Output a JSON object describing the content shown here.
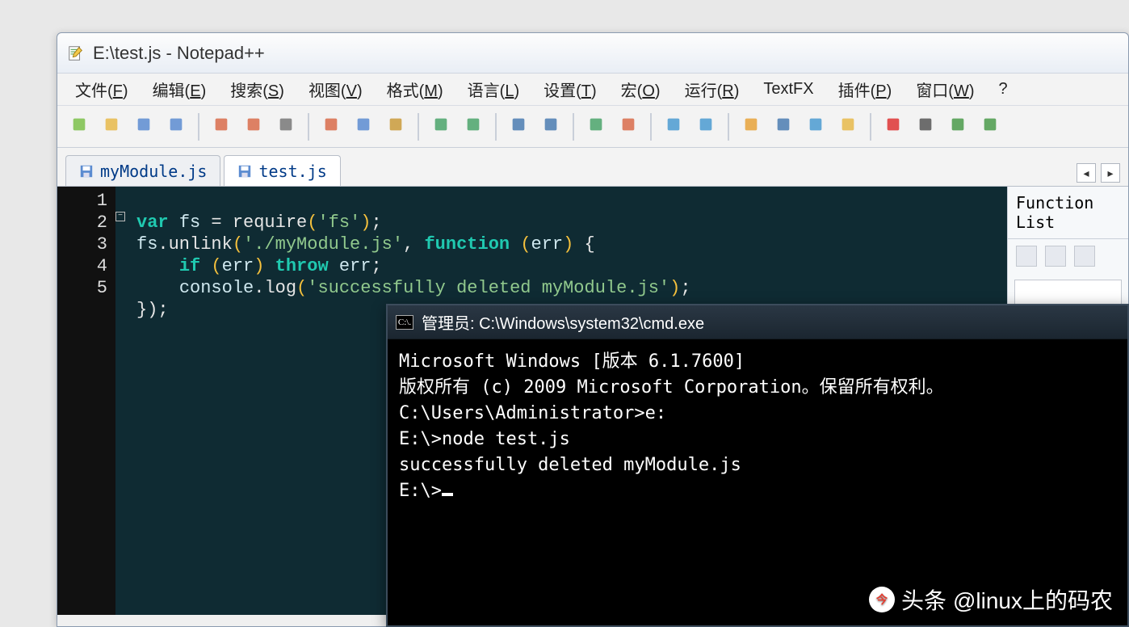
{
  "npp": {
    "title": "E:\\test.js - Notepad++",
    "menus": [
      {
        "label": "文件",
        "accel": "F"
      },
      {
        "label": "编辑",
        "accel": "E"
      },
      {
        "label": "搜索",
        "accel": "S"
      },
      {
        "label": "视图",
        "accel": "V"
      },
      {
        "label": "格式",
        "accel": "M"
      },
      {
        "label": "语言",
        "accel": "L"
      },
      {
        "label": "设置",
        "accel": "T"
      },
      {
        "label": "宏",
        "accel": "O"
      },
      {
        "label": "运行",
        "accel": "R"
      },
      {
        "label": "TextFX",
        "accel": ""
      },
      {
        "label": "插件",
        "accel": "P"
      },
      {
        "label": "窗口",
        "accel": "W"
      },
      {
        "label": "?",
        "accel": ""
      }
    ],
    "toolbar_icons": [
      "new-file",
      "open-file",
      "save",
      "save-all",
      "|",
      "close",
      "close-all",
      "print",
      "|",
      "cut",
      "copy",
      "paste",
      "|",
      "undo",
      "redo",
      "|",
      "find",
      "find-replace",
      "|",
      "zoom-in",
      "zoom-out",
      "|",
      "sync-v",
      "sync-h",
      "|",
      "wrap",
      "show-all",
      "indent-guide",
      "lang",
      "|",
      "record",
      "stop",
      "play",
      "play-multi"
    ],
    "tabs": [
      {
        "label": "myModule.js",
        "active": false,
        "dirty": false
      },
      {
        "label": "test.js",
        "active": true,
        "dirty": false
      }
    ],
    "side_panel_title": "Function List",
    "code_lines": [
      "1",
      "2",
      "3",
      "4",
      "5"
    ],
    "code": {
      "l1": {
        "var": "var",
        "fs": "fs",
        "eq": " = ",
        "req": "require",
        "op": "(",
        "q1": "'",
        "arg": "fs",
        "q2": "'",
        "cp": ")",
        "sc": ";"
      },
      "l2": {
        "obj": "fs",
        "dot1": ".",
        "m": "unlink",
        "op": "(",
        "q1": "'",
        "path": "./myModule.js",
        "q2": "'",
        "com": ", ",
        "fn": "function",
        "sp": " ",
        "op2": "(",
        "p": "err",
        "cp2": ")",
        "br": " {"
      },
      "l3": {
        "ind": "    ",
        "if": "if",
        "op": " (",
        "e": "err",
        "cp": ") ",
        "thr": "throw",
        "sp": " ",
        "e2": "err",
        "sc": ";"
      },
      "l4": {
        "ind": "    ",
        "c": "console",
        "dot": ".",
        "log": "log",
        "op": "(",
        "q1": "'",
        "msg": "successfully deleted myModule.js",
        "q2": "'",
        "cp": ")",
        "sc": ";"
      },
      "l5": {
        "br": "});"
      }
    }
  },
  "cmd": {
    "title": "管理员: C:\\Windows\\system32\\cmd.exe",
    "icon_text": "C:\\.",
    "lines": [
      "Microsoft Windows [版本 6.1.7600]",
      "版权所有 (c) 2009 Microsoft Corporation。保留所有权利。",
      "",
      "C:\\Users\\Administrator>e:",
      "",
      "E:\\>node test.js",
      "successfully deleted myModule.js",
      "",
      "E:\\>"
    ]
  },
  "watermark": {
    "brand": "头条",
    "handle": "@linux上的码农"
  }
}
